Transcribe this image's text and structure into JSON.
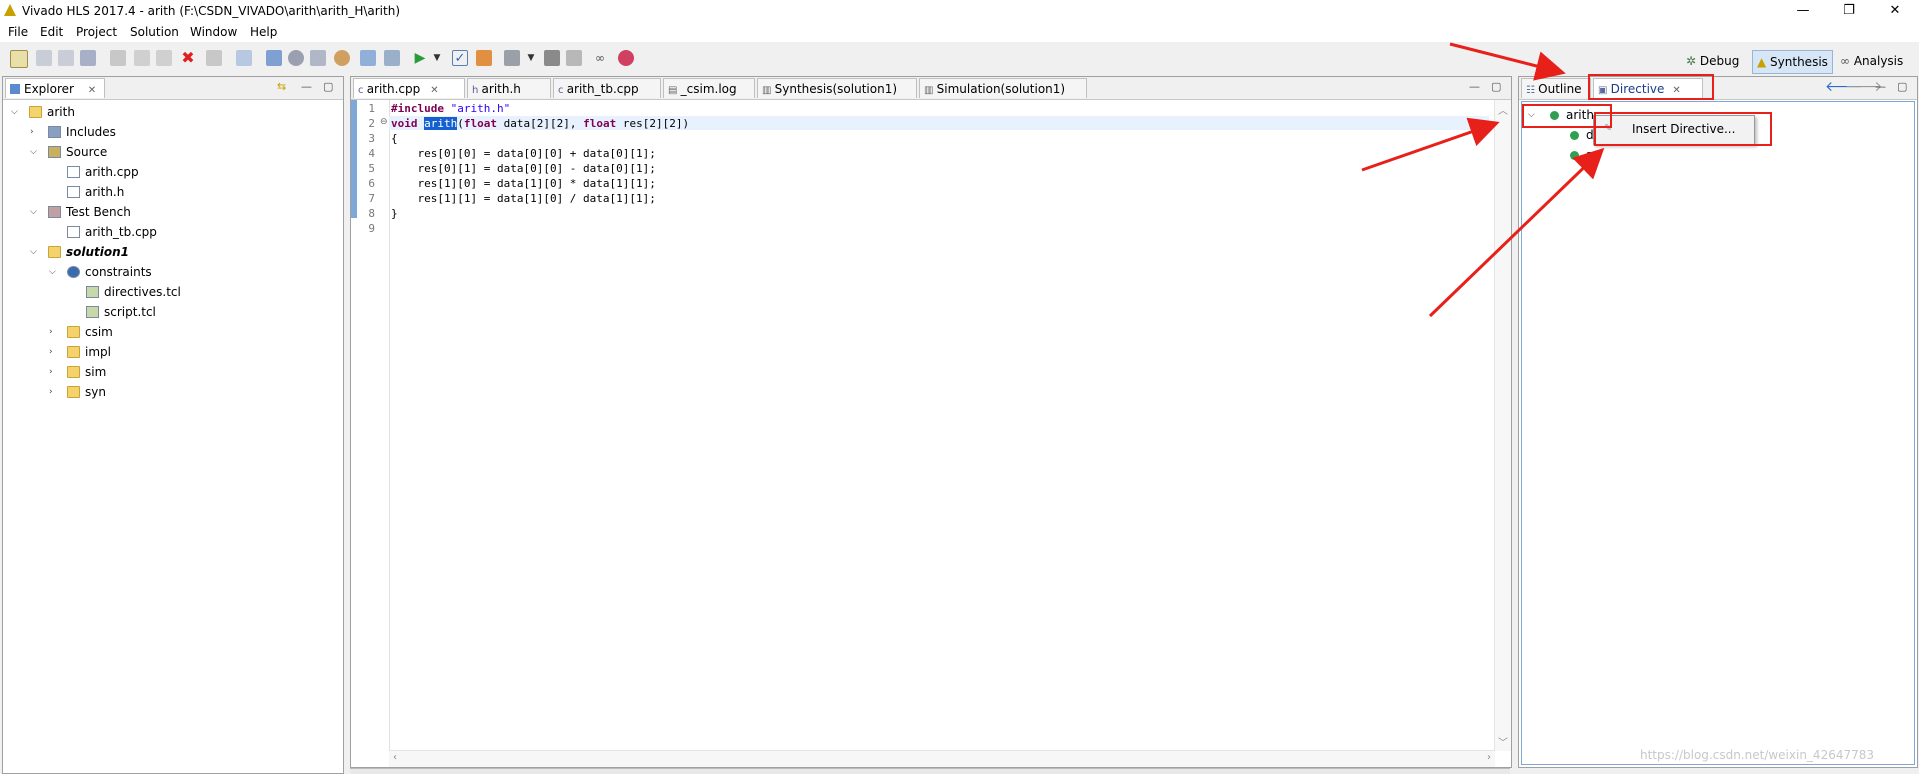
{
  "window": {
    "title": "Vivado HLS 2017.4 - arith (F:\\CSDN_VIVADO\\arith\\arith_H\\arith)",
    "minimize": "—",
    "restore": "❐",
    "close": "✕"
  },
  "menu": [
    "File",
    "Edit",
    "Project",
    "Solution",
    "Window",
    "Help"
  ],
  "perspectives": {
    "debug": "Debug",
    "synthesis": "Synthesis",
    "analysis": "Analysis"
  },
  "explorer": {
    "title": "Explorer",
    "tree": [
      {
        "label": "arith",
        "depth": 0,
        "expanded": true,
        "icon": "project-folder-icon"
      },
      {
        "label": "Includes",
        "depth": 1,
        "expanded": false,
        "icon": "includes-icon"
      },
      {
        "label": "Source",
        "depth": 1,
        "expanded": true,
        "icon": "source-icon"
      },
      {
        "label": "arith.cpp",
        "depth": 2,
        "icon": "cpp-file-icon"
      },
      {
        "label": "arith.h",
        "depth": 2,
        "icon": "header-file-icon"
      },
      {
        "label": "Test Bench",
        "depth": 1,
        "expanded": true,
        "icon": "testbench-icon"
      },
      {
        "label": "arith_tb.cpp",
        "depth": 2,
        "icon": "cpp-file-icon"
      },
      {
        "label": "solution1",
        "depth": 1,
        "expanded": true,
        "icon": "solution-folder-icon",
        "bold": true
      },
      {
        "label": "constraints",
        "depth": 2,
        "expanded": true,
        "icon": "gear-icon"
      },
      {
        "label": "directives.tcl",
        "depth": 3,
        "icon": "tcl-file-icon"
      },
      {
        "label": "script.tcl",
        "depth": 3,
        "icon": "tcl-file-icon"
      },
      {
        "label": "csim",
        "depth": 2,
        "expanded": false,
        "icon": "folder-icon"
      },
      {
        "label": "impl",
        "depth": 2,
        "expanded": false,
        "icon": "folder-icon"
      },
      {
        "label": "sim",
        "depth": 2,
        "expanded": false,
        "icon": "folder-icon"
      },
      {
        "label": "syn",
        "depth": 2,
        "expanded": false,
        "icon": "folder-icon"
      }
    ]
  },
  "editor": {
    "tabs": [
      "arith.cpp",
      "arith.h",
      "arith_tb.cpp",
      "_csim.log",
      "Synthesis(solution1)",
      "Simulation(solution1)"
    ],
    "active_tab": 0,
    "line_numbers": [
      "1",
      "2",
      "3",
      "4",
      "5",
      "6",
      "7",
      "8",
      "9"
    ],
    "lines": [
      "#include \"arith.h\"",
      "void arith(float data[2][2], float res[2][2])",
      "{",
      "    res[0][0] = data[0][0] + data[0][1];",
      "    res[0][1] = data[0][0] - data[0][1];",
      "    res[1][0] = data[1][0] * data[1][1];",
      "    res[1][1] = data[1][0] / data[1][1];",
      "}",
      ""
    ]
  },
  "right_panel": {
    "tabs": [
      "Outline",
      "Directive"
    ],
    "tree_root": "arith",
    "children": [
      "d",
      "s"
    ],
    "context_menu": {
      "item": "Insert Directive..."
    }
  },
  "watermark": "https://blog.csdn.net/weixin_42647783"
}
